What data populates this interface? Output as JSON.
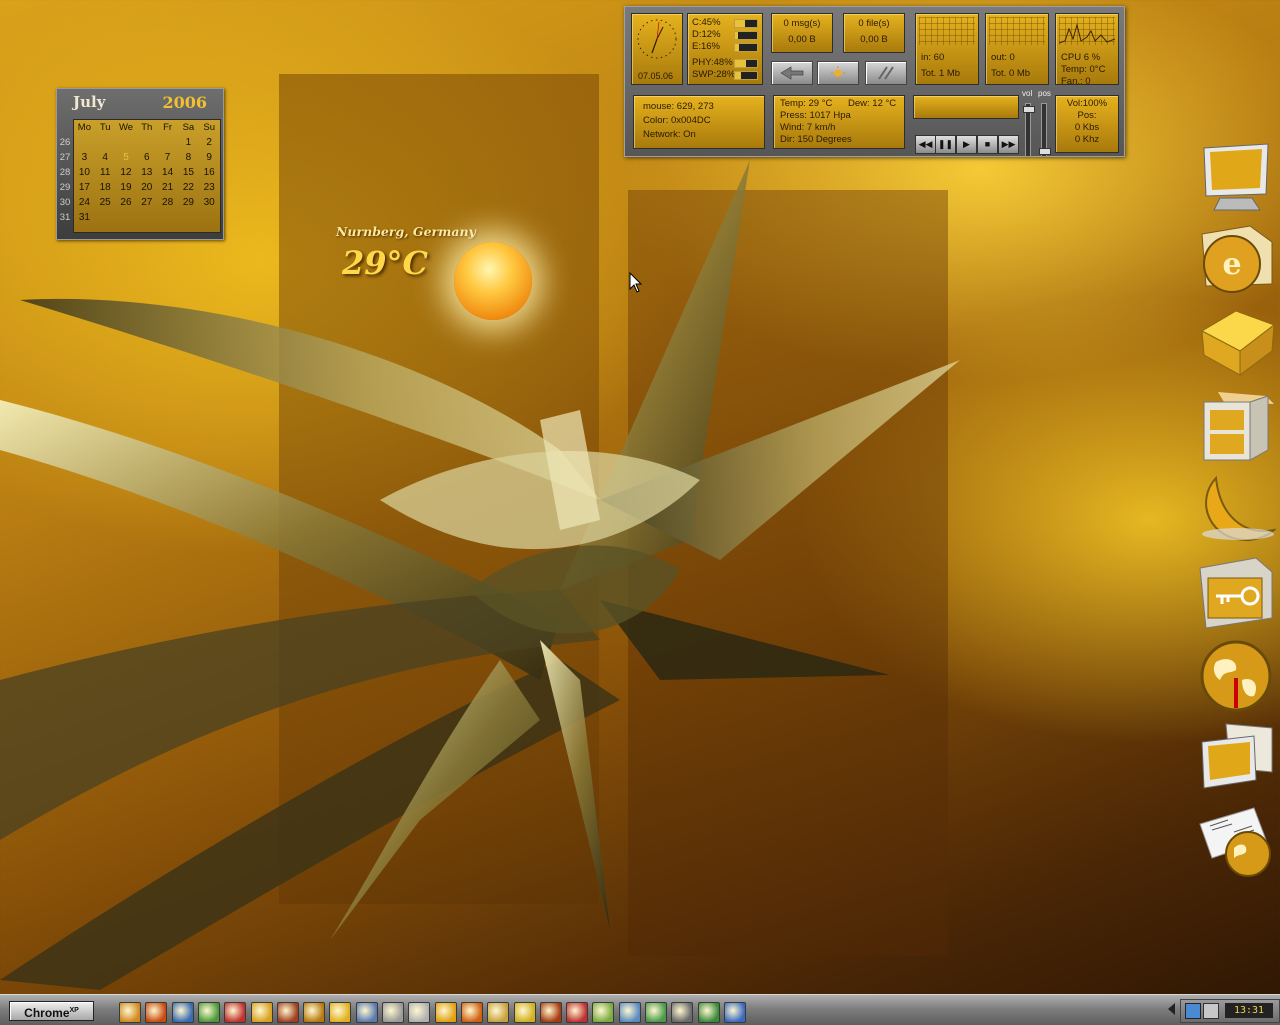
{
  "calendar": {
    "month": "July",
    "year": "2006",
    "weekday_headers": [
      "Mo",
      "Tu",
      "We",
      "Th",
      "Fr",
      "Sa",
      "Su"
    ],
    "weeks": [
      "26",
      "27",
      "28",
      "29",
      "30",
      "31"
    ],
    "rows": [
      [
        "",
        "",
        "",
        "",
        "",
        "1",
        "2"
      ],
      [
        "3",
        "4",
        "5",
        "6",
        "7",
        "8",
        "9"
      ],
      [
        "10",
        "11",
        "12",
        "13",
        "14",
        "15",
        "16"
      ],
      [
        "17",
        "18",
        "19",
        "20",
        "21",
        "22",
        "23"
      ],
      [
        "24",
        "25",
        "26",
        "27",
        "28",
        "29",
        "30"
      ],
      [
        "31",
        "",
        "",
        "",
        "",
        "",
        ""
      ]
    ],
    "today": "5"
  },
  "weather": {
    "city": "Nurnberg, Germany",
    "temperature": "29°C"
  },
  "monitor": {
    "clock_date": "07.05.06",
    "drives": {
      "c": "C:45%",
      "d": "D:12%",
      "e": "E:16%",
      "c_pct": 45,
      "d_pct": 12,
      "e_pct": 16
    },
    "memory": {
      "phy": "PHY:48%",
      "swp": "SWP:28%",
      "phy_pct": 48,
      "swp_pct": 28
    },
    "mail": {
      "count": "0 msg(s)",
      "size": "0,00 B"
    },
    "files": {
      "count": "0 file(s)",
      "size": "0,00 B"
    },
    "net_in": {
      "rate": "in: 60",
      "total": "Tot. 1 Mb"
    },
    "net_out": {
      "rate": "out: 0",
      "total": "Tot. 0 Mb"
    },
    "cpu": {
      "usage": "CPU  6 %",
      "temp": "Temp: 0°C",
      "fan": "Fan.: 0"
    },
    "mouse": {
      "pos": "mouse: 629, 273",
      "color": "Color: 0x004DC",
      "network": "Network: On"
    },
    "weather_detail": {
      "temp": "Temp: 29 °C",
      "dew": "Dew:  12 °C",
      "press": "Press:  1017 Hpa",
      "wind": "Wind:  7 km/h",
      "dir": "Dir:   150 Degrees"
    },
    "audio": {
      "vol": "Vol:100%",
      "pos": "Pos:",
      "kbs": "0 Kbs",
      "khz": "0 Khz"
    },
    "slider_labels": {
      "vol": "vol",
      "pos": "pos"
    }
  },
  "taskbar": {
    "start_label": "Chrome",
    "start_sup": "XP",
    "clock": "13:31"
  }
}
